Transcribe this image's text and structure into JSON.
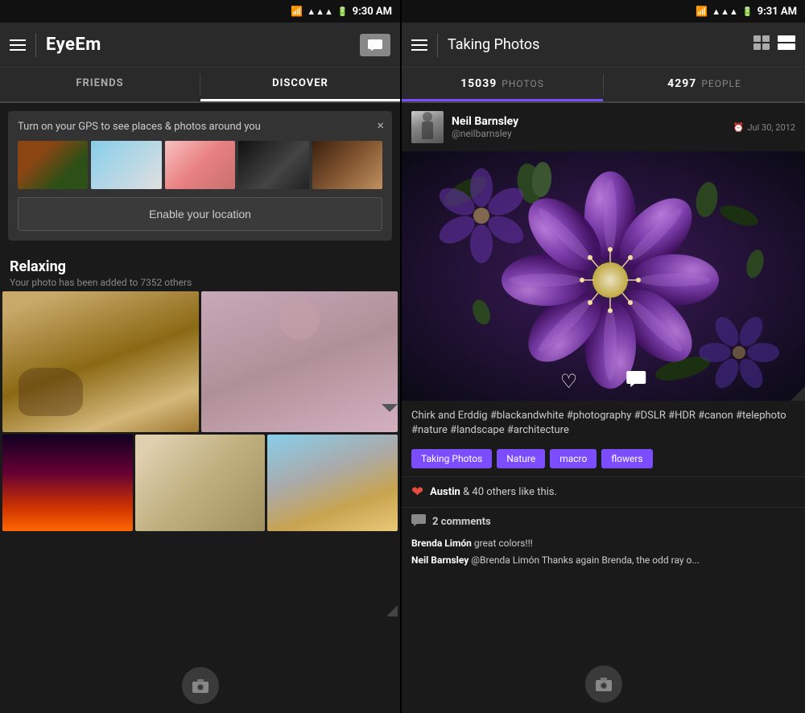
{
  "left": {
    "status_bar": {
      "time": "9:30 AM"
    },
    "header": {
      "title": "EyeEm",
      "hamburger_label": "menu",
      "chat_label": "chat"
    },
    "tabs": [
      {
        "label": "FRIENDS",
        "active": false
      },
      {
        "label": "DISCOVER",
        "active": true
      }
    ],
    "gps_banner": {
      "text": "Turn on your GPS to see places & photos around you",
      "close_label": "×",
      "button_label": "Enable your location"
    },
    "section": {
      "title": "Relaxing",
      "subtitle": "Your photo has been added to 7352 others"
    }
  },
  "right": {
    "status_bar": {
      "time": "9:31 AM"
    },
    "header": {
      "title": "Taking Photos",
      "hamburger_label": "menu"
    },
    "tabs": [
      {
        "count": "15039",
        "label": "PHOTOS",
        "active": true
      },
      {
        "count": "4297",
        "label": "PEOPLE",
        "active": false
      }
    ],
    "post": {
      "username": "Neil Barnsley",
      "handle": "@neilbarnsley",
      "time": "Jul 30, 2012",
      "caption": "Chirk and Erddig #blackandwhite #photography #DSLR #HDR #canon #telephoto #nature #landscape #architecture",
      "tags": [
        "Taking Photos",
        "Nature",
        "macro",
        "flowers"
      ],
      "likes_text": "Austin & 40 others like this.",
      "likes_user": "Austin",
      "comments_count": "2 comments",
      "comments": [
        {
          "author": "Brenda Limón",
          "text": "great colors!!!"
        },
        {
          "author": "Neil Barnsley",
          "text": "@Brenda Limón Thanks again Brenda, the odd ray o..."
        }
      ]
    }
  }
}
